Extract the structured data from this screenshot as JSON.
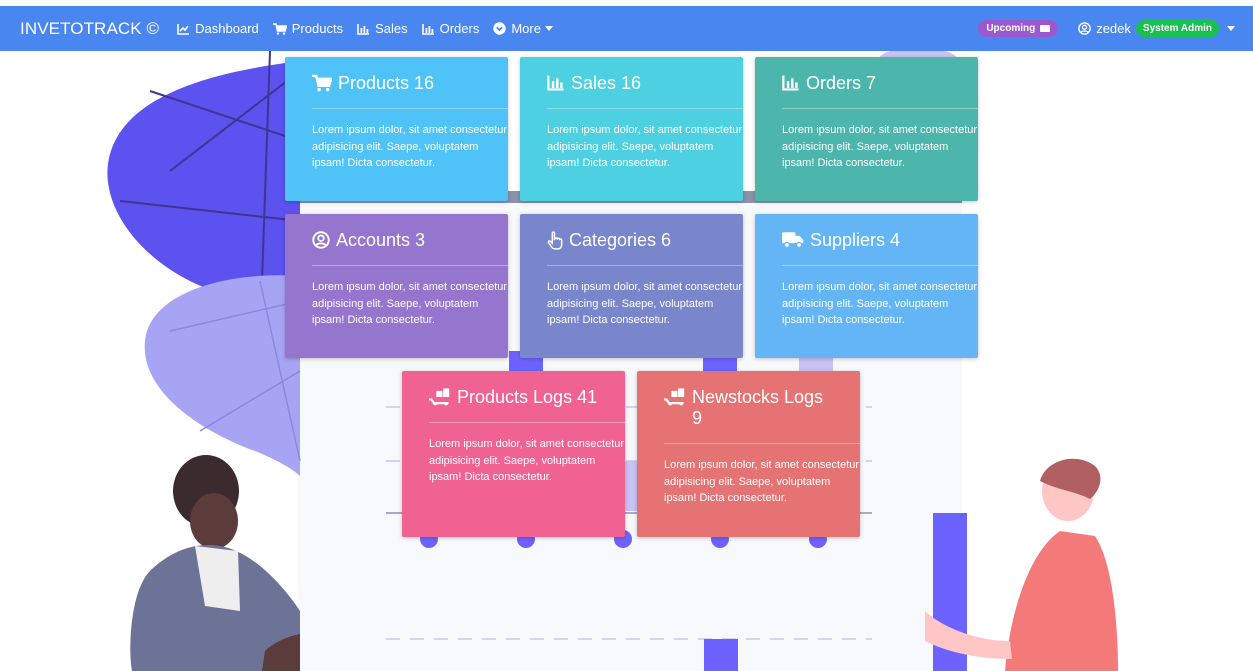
{
  "navbar": {
    "brand": "INVETOTRACK ©",
    "links": [
      {
        "label": "Dashboard",
        "icon": "chart-line-icon"
      },
      {
        "label": "Products",
        "icon": "cart-icon"
      },
      {
        "label": "Sales",
        "icon": "chart-bar-icon"
      },
      {
        "label": "Orders",
        "icon": "chart-bar-icon"
      },
      {
        "label": "More",
        "icon": "chevron-circle-down-icon",
        "dropdown": true
      }
    ],
    "upcoming_label": "Upcoming",
    "user": {
      "name": "zedek",
      "role": "System Admin"
    }
  },
  "cards": [
    {
      "title": "Products 16",
      "icon": "cart-icon",
      "color": "#4fc3f7",
      "text": "Lorem ipsum dolor, sit amet consectetur adipisicing elit. Saepe, voluptatem ipsam! Dicta consectetur."
    },
    {
      "title": "Sales 16",
      "icon": "chart-bar-icon",
      "color": "#4dd0e1",
      "text": "Lorem ipsum dolor, sit amet consectetur adipisicing elit. Saepe, voluptatem ipsam! Dicta consectetur."
    },
    {
      "title": "Orders 7",
      "icon": "chart-bar-icon",
      "color": "#4db6ac",
      "text": "Lorem ipsum dolor, sit amet consectetur adipisicing elit. Saepe, voluptatem ipsam! Dicta consectetur."
    },
    {
      "title": "Accounts 3",
      "icon": "user-circle-icon",
      "color": "#9575cd",
      "text": "Lorem ipsum dolor, sit amet consectetur adipisicing elit. Saepe, voluptatem ipsam! Dicta consectetur."
    },
    {
      "title": "Categories 6",
      "icon": "hand-pointer-icon",
      "color": "#7986cb",
      "text": "Lorem ipsum dolor, sit amet consectetur adipisicing elit. Saepe, voluptatem ipsam! Dicta consectetur."
    },
    {
      "title": "Suppliers 4",
      "icon": "truck-icon",
      "color": "#64b5f6",
      "text": "Lorem ipsum dolor, sit amet consectetur adipisicing elit. Saepe, voluptatem ipsam! Dicta consectetur."
    },
    {
      "title": "Products Logs 41",
      "icon": "dolly-icon",
      "color": "#f06292",
      "text": "Lorem ipsum dolor, sit amet consectetur adipisicing elit. Saepe, voluptatem ipsam! Dicta consectetur."
    },
    {
      "title": "Newstocks Logs 9",
      "icon": "dolly-icon",
      "color": "#e57373",
      "text": "Lorem ipsum dolor, sit amet consectetur adipisicing elit. Saepe, voluptatem ipsam! Dicta consectetur."
    }
  ],
  "colors": {
    "navbar": "#4a86f0",
    "accent_purple": "#6c63ff",
    "badge_upcoming": "#9b59d0",
    "badge_admin": "#18c04f"
  }
}
